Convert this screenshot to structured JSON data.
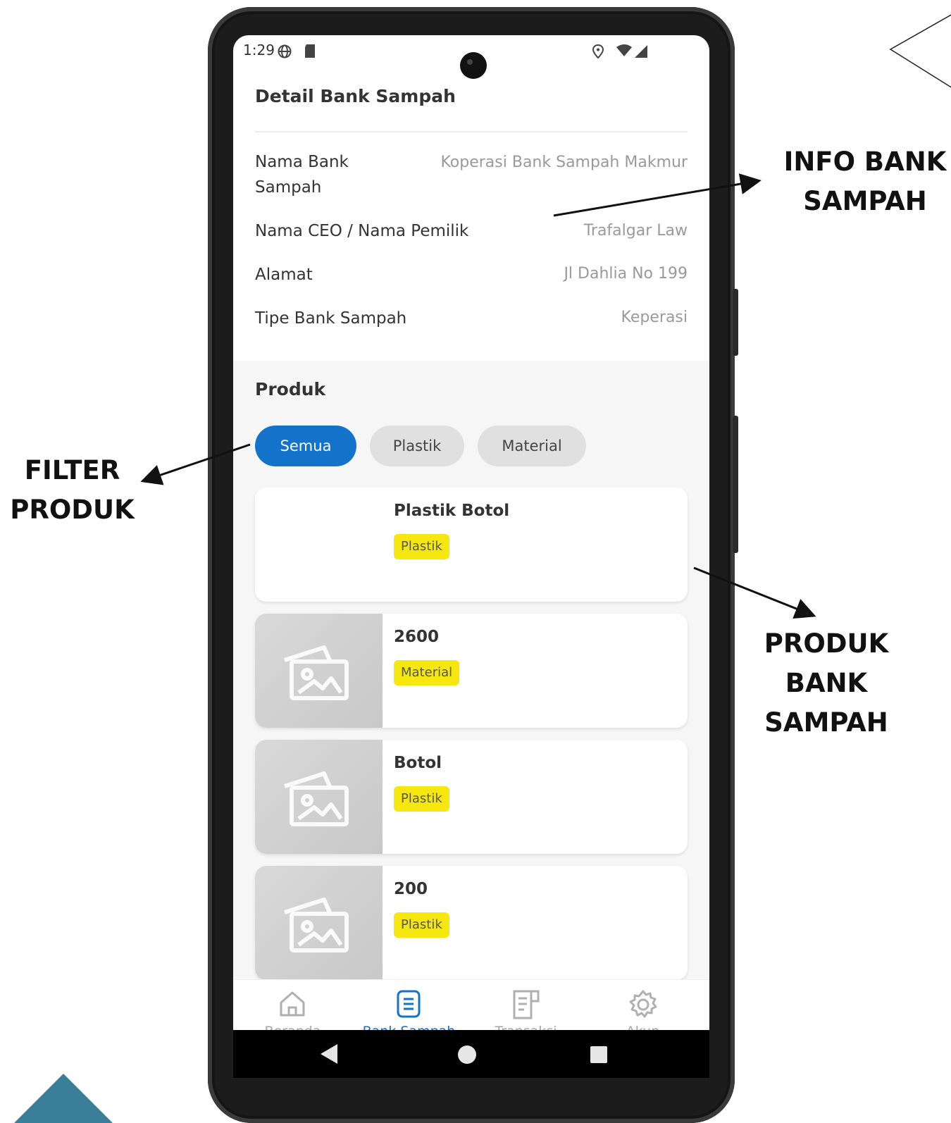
{
  "annotations": {
    "info": "INFO BANK\nSAMPAH",
    "filter": "FILTER\nPRODUK",
    "produk": "PRODUK\nBANK\nSAMPAH"
  },
  "status_bar": {
    "time": "1:29"
  },
  "page_title": "Detail Bank Sampah",
  "info": [
    {
      "label": "Nama Bank Sampah",
      "value": "Koperasi Bank Sampah Makmur"
    },
    {
      "label": "Nama CEO / Nama Pemilik",
      "value": "Trafalgar Law"
    },
    {
      "label": "Alamat",
      "value": "Jl Dahlia No 199"
    },
    {
      "label": "Tipe Bank Sampah",
      "value": "Keperasi"
    }
  ],
  "produk": {
    "title": "Produk",
    "filters": [
      {
        "label": "Semua",
        "selected": true
      },
      {
        "label": "Plastik",
        "selected": false
      },
      {
        "label": "Material",
        "selected": false
      }
    ],
    "items": [
      {
        "name": "Plastik Botol",
        "category": "Plastik"
      },
      {
        "name": "2600",
        "category": "Material"
      },
      {
        "name": "Botol",
        "category": "Plastik"
      },
      {
        "name": "200",
        "category": "Plastik"
      }
    ]
  },
  "bottom_nav": [
    {
      "label": "Beranda",
      "icon": "home-icon",
      "active": false
    },
    {
      "label": "Bank Sampah",
      "icon": "document-icon",
      "active": true
    },
    {
      "label": "Transaksi",
      "icon": "receipt-icon",
      "active": false
    },
    {
      "label": "Akun",
      "icon": "gear-icon",
      "active": false
    }
  ],
  "colors": {
    "accent": "#1372c9",
    "tag": "#f6e80f",
    "decor": "#3a7f97"
  }
}
